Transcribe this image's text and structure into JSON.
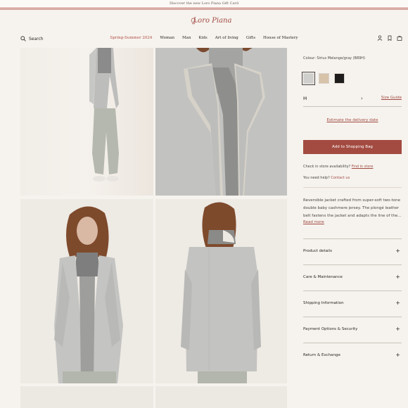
{
  "promo": {
    "text": "Discover the new Loro Piana Gift Card"
  },
  "header": {
    "logo": "Loro Piana",
    "search_label": "Search",
    "nav": [
      "Spring-Summer 2024",
      "Woman",
      "Man",
      "Kids",
      "Art of living",
      "Gifts",
      "House of Mastery"
    ]
  },
  "product": {
    "colour_label": "Colour: Sirius Melange/gray (B89H)",
    "swatches": [
      {
        "name": "light gray",
        "color": "#cfcfcd"
      },
      {
        "name": "beige",
        "color": "#d7c3a9"
      },
      {
        "name": "black",
        "color": "#1f1d1c"
      }
    ],
    "size_value": "M",
    "size_guide": "Size Guide",
    "delivery_link": "Estimate the delivery date",
    "add_button": "Add to Shopping Bag",
    "check_store_text": "Check in store availability?",
    "find_in_store": "Find in store",
    "need_help_text": "You need help?",
    "contact_us": "Contact us",
    "description": "Reversible jacket crafted from super-soft two-tone double baby cashmere jersey. The plongé leather belt fastens the jacket and adapts the line of the...",
    "read_more": "Read more",
    "accordions": [
      "Product details",
      "Care & Maintenance",
      "Shipping Information",
      "Payment Options & Security",
      "Return & Exchange"
    ]
  },
  "colors": {
    "accent": "#a34b41",
    "background": "#f6f3ee"
  }
}
